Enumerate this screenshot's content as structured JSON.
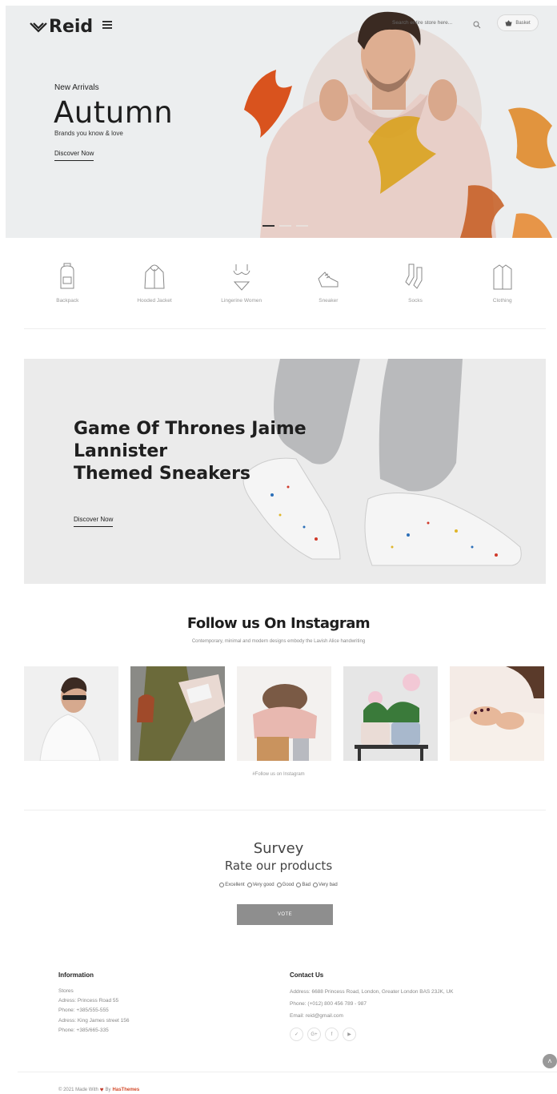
{
  "header": {
    "logo": "Reid",
    "search_placeholder": "Search entire store here...",
    "basket_label": "Basket"
  },
  "hero": {
    "subtitle": "New Arrivals",
    "title": "Autumn",
    "tagline": "Brands you know & love",
    "cta": "Discover Now",
    "slides": 3,
    "active_slide": 1
  },
  "categories": [
    {
      "label": "Backpack",
      "icon": "backpack-icon"
    },
    {
      "label": "Hooded Jacket",
      "icon": "hooded-jacket-icon"
    },
    {
      "label": "Lingerine Women",
      "icon": "lingerie-icon"
    },
    {
      "label": "Sneaker",
      "icon": "sneaker-icon"
    },
    {
      "label": "Socks",
      "icon": "socks-icon"
    },
    {
      "label": "Clothing",
      "icon": "shirt-icon"
    }
  ],
  "banner": {
    "title_line1": "Game Of Thrones Jaime",
    "title_line2": "Lannister",
    "title_line3": "Themed Sneakers",
    "cta": "Discover Now"
  },
  "instagram": {
    "title": "Follow us On Instagram",
    "subtitle": "Contemporary, minimal and modern designs embody the Lavish Alice handwriting",
    "link": "#Follow us on Instagram"
  },
  "survey": {
    "title": "Survey",
    "subtitle": "Rate our products",
    "options": [
      "Excellent",
      "Very good",
      "Good",
      "Bad",
      "Very bad"
    ],
    "vote_label": "VOTE"
  },
  "footer": {
    "info_heading": "Information",
    "info_lines": [
      "Stores",
      "Adress: Princess Road 55",
      "Phone: +385/555-555",
      "Adress: King James street 156",
      "Phone: +385/665-335"
    ],
    "contact_heading": "Contact Us",
    "contact_lines": [
      "Address: 6688 Princess Road, London, Greater London BAS 23JK, UK",
      "Phone: (+012) 800 456 789 - 987",
      "Email: reid@gmail.com"
    ],
    "socials": [
      "twitter-icon",
      "google-plus-icon",
      "facebook-icon",
      "youtube-icon"
    ],
    "copyright_prefix": "© 2021 Made With",
    "copyright_by": "By",
    "copyright_brand": "HasThemes"
  },
  "colors": {
    "hero_bg": "#eceeef",
    "accent": "#d34a2a",
    "vote_bg": "#8e8e8e"
  }
}
